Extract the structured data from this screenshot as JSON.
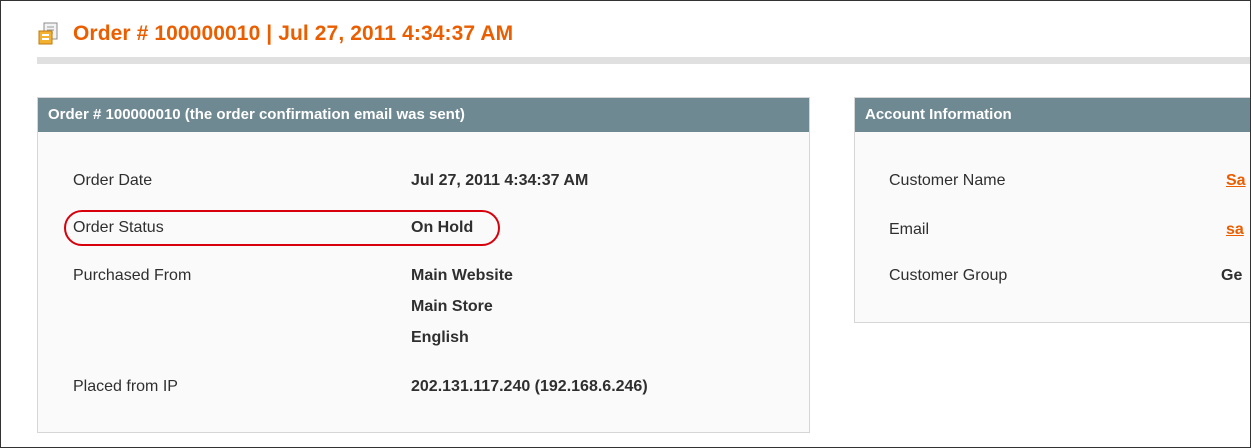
{
  "header": {
    "icon": "order-document-icon",
    "title": "Order # 100000010 | Jul 27, 2011 4:34:37 AM"
  },
  "order_box": {
    "title": "Order # 100000010 (the order confirmation email was sent)",
    "rows": [
      {
        "label": "Order Date",
        "value": "Jul 27, 2011 4:34:37 AM"
      },
      {
        "label": "Order Status",
        "value": "On Hold"
      },
      {
        "label": "Purchased From",
        "values": [
          "Main Website",
          "Main Store",
          "English"
        ]
      },
      {
        "label": "Placed from IP",
        "value": "202.131.117.240 (192.168.6.246)"
      }
    ]
  },
  "account_box": {
    "title": "Account Information",
    "rows": [
      {
        "label": "Customer Name",
        "value": "Sa"
      },
      {
        "label": "Email",
        "value": "sa"
      },
      {
        "label": "Customer Group",
        "value": "Ge"
      }
    ]
  },
  "colors": {
    "accent": "#eb5e00",
    "box_header": "#6f8992",
    "highlight": "#d8000c"
  }
}
